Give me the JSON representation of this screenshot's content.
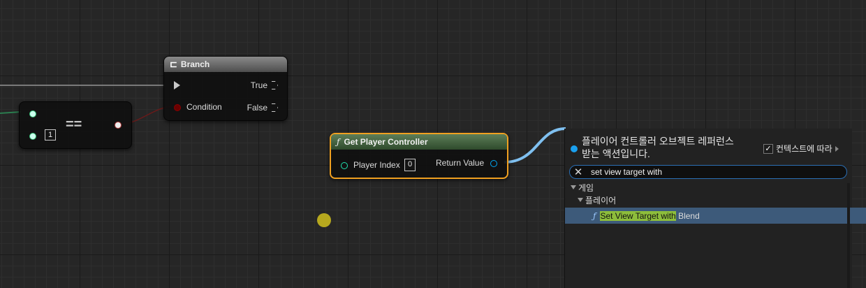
{
  "nodes": {
    "equals": {
      "title": "==",
      "index_value": "1"
    },
    "branch": {
      "title": "Branch",
      "true_label": "True",
      "false_label": "False",
      "condition_label": "Condition"
    },
    "get_player_controller": {
      "title": "Get Player Controller",
      "function_icon": "ƒ",
      "player_index_label": "Player Index",
      "player_index_value": "0",
      "return_value_label": "Return Value"
    }
  },
  "action_menu": {
    "title_line1": "플레이어 컨트롤러 오브젝트 레퍼런스",
    "title_line2": "받는 액션입니다.",
    "context_label": "컨텍스트에 따라",
    "context_checked": "✓",
    "search_clear": "✕",
    "search_value": "set view target with",
    "categories": [
      {
        "label": "게임"
      },
      {
        "label": "플레이어"
      }
    ],
    "result": {
      "function_icon": "ƒ",
      "match_text": "Set View Target with",
      "rest_text": " Blend"
    }
  },
  "colors": {
    "accent_blue": "#1aa0ef",
    "selection_orange": "#f0a020",
    "highlight_green": "#8dbd3b",
    "bool_pin": "#8b0000",
    "int_pin": "#1fe3af",
    "object_pin": "#00a8f4"
  }
}
